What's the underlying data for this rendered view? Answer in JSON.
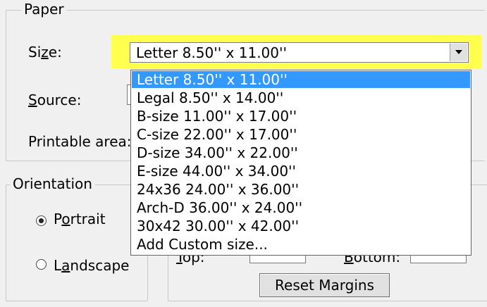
{
  "paper": {
    "group_title": "Paper",
    "size_label_pre": "Si",
    "size_label_key": "z",
    "size_label_post": "e:",
    "source_label_key": "S",
    "source_label_post": "ource:",
    "printable_area_label": "Printable area:",
    "size_selected_value": "Letter  8.50'' x 11.00''",
    "size_options": [
      "Letter  8.50'' x 11.00''",
      "Legal  8.50'' x 14.00''",
      "B-size  11.00'' x 17.00''",
      "C-size  22.00'' x 17.00''",
      "D-size  34.00'' x 22.00''",
      "E-size  44.00'' x 34.00''",
      "24x36  24.00'' x 36.00''",
      "Arch-D  36.00'' x 24.00''",
      "30x42  30.00'' x 42.00''",
      "Add Custom size..."
    ],
    "highlight_color": "#ffff4d",
    "selection_color": "#3399ff"
  },
  "orientation": {
    "group_title": "Orientation",
    "portrait_pre": "P",
    "portrait_key": "o",
    "portrait_post": "rtrait",
    "landscape_pre": "L",
    "landscape_key": "a",
    "landscape_post": "ndscape",
    "selected": "Portrait"
  },
  "margins": {
    "top_label_key": "T",
    "top_label_post": "op:",
    "bottom_label_key": "B",
    "bottom_label_post": "ottom:",
    "reset_button_label": "Reset Margins"
  }
}
